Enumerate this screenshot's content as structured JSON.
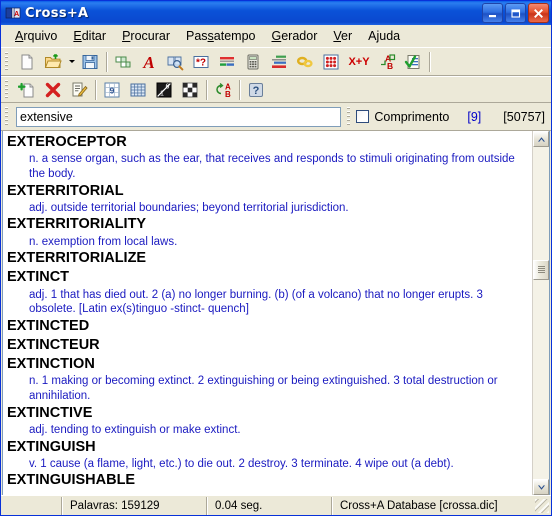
{
  "window": {
    "title": "Cross+A",
    "icon": "book-icon",
    "controls": {
      "minimize": "minimize-button",
      "maximize": "maximize-button",
      "close": "close-button"
    },
    "accent": "#0a52d8",
    "face": "#ece9d8"
  },
  "menu": [
    {
      "label": "Arquivo",
      "accel": "A"
    },
    {
      "label": "Editar",
      "accel": "E"
    },
    {
      "label": "Procurar",
      "accel": "P"
    },
    {
      "label": "Passatempo",
      "accel": "s"
    },
    {
      "label": "Gerador",
      "accel": "G"
    },
    {
      "label": "Ver",
      "accel": "V"
    },
    {
      "label": "Ajuda",
      "accel": ""
    }
  ],
  "toolbar_main": [
    {
      "name": "new-document-icon",
      "tip": "Novo"
    },
    {
      "name": "open-folder-icon",
      "tip": "Abrir"
    },
    {
      "name": "open-dropdown-arrow",
      "tip": "Abrir recentes"
    },
    {
      "name": "save-icon",
      "tip": "Salvar"
    },
    {
      "name": "separator-1",
      "tip": ""
    },
    {
      "name": "crossword-grid-icon",
      "tip": "Palavras cruzadas"
    },
    {
      "name": "anagram-a-icon",
      "tip": "Anagrama"
    },
    {
      "name": "dictionary-search-icon",
      "tip": "Procurar no dicionario"
    },
    {
      "name": "wildcard-icon",
      "tip": "Mascara"
    },
    {
      "name": "word-bars-icon",
      "tip": "Estatisticas"
    },
    {
      "name": "calculator-icon",
      "tip": "Calculadora"
    },
    {
      "name": "chart-bars-icon",
      "tip": "Grafico"
    },
    {
      "name": "chain-links-icon",
      "tip": "Cadeia"
    },
    {
      "name": "number-grid-icon",
      "tip": "Grade numerica"
    },
    {
      "name": "xy-equation-icon",
      "tip": "X+Y",
      "text": "X+Y"
    },
    {
      "name": "translate-ab-icon",
      "tip": "Traduzir"
    },
    {
      "name": "checklist-icon",
      "tip": "Verificar"
    },
    {
      "name": "separator-2",
      "tip": ""
    }
  ],
  "toolbar_second": [
    {
      "name": "add-word-icon",
      "tip": "Adicionar"
    },
    {
      "name": "delete-word-icon",
      "tip": "Excluir"
    },
    {
      "name": "edit-word-icon",
      "tip": "Editar"
    },
    {
      "name": "separator-3",
      "tip": ""
    },
    {
      "name": "sudoku-icon",
      "tip": "Sudoku"
    },
    {
      "name": "grid-table-icon",
      "tip": "Grade"
    },
    {
      "name": "kakuro-icon",
      "tip": "Kakuro"
    },
    {
      "name": "nonogram-icon",
      "tip": "Nonograma"
    },
    {
      "name": "separator-4",
      "tip": ""
    },
    {
      "name": "cipher-ab-icon",
      "tip": "Criptografia"
    },
    {
      "name": "separator-5",
      "tip": ""
    },
    {
      "name": "help-icon",
      "tip": "Ajuda"
    }
  ],
  "search": {
    "value": "extensive",
    "placeholder": "",
    "length_label": "Comprimento",
    "length_checked": false,
    "match_count": "[9]",
    "total_count": "[50757]",
    "match_color": "#0000c8"
  },
  "entries": [
    {
      "word": "EXTEROCEPTOR",
      "definition": "n. a sense organ, such as the ear, that receives and responds to stimuli originating from outside the body."
    },
    {
      "word": "EXTERRITORIAL",
      "definition": "adj. outside territorial boundaries; beyond territorial jurisdiction."
    },
    {
      "word": "EXTERRITORIALITY",
      "definition": "n. exemption from local laws."
    },
    {
      "word": "EXTERRITORIALIZE",
      "definition": ""
    },
    {
      "word": "EXTINCT",
      "definition": "adj. 1 that has died out. 2 (a) no longer burning. (b) (of a volcano) that no longer erupts. 3 obsolete. [Latin ex(s)tinguo -stinct- quench]"
    },
    {
      "word": "EXTINCTED",
      "definition": ""
    },
    {
      "word": "EXTINCTEUR",
      "definition": ""
    },
    {
      "word": "EXTINCTION",
      "definition": "n. 1 making or becoming extinct. 2 extinguishing or being extinguished. 3 total destruction or annihilation."
    },
    {
      "word": "EXTINCTIVE",
      "definition": "adj. tending to extinguish or make extinct."
    },
    {
      "word": "EXTINGUISH",
      "definition": "v. 1 cause (a flame, light, etc.) to die out. 2 destroy. 3 terminate. 4 wipe out (a debt)."
    },
    {
      "word": "EXTINGUISHABLE",
      "definition": ""
    }
  ],
  "scrollbar": {
    "up_arrow": "scroll-up-icon",
    "down_arrow": "scroll-down-icon",
    "thumb_position_pct": 34
  },
  "status": {
    "words": "Palavras: 159129",
    "time": "0.04 seg.",
    "database": "Cross+A Database [crossa.dic]"
  }
}
